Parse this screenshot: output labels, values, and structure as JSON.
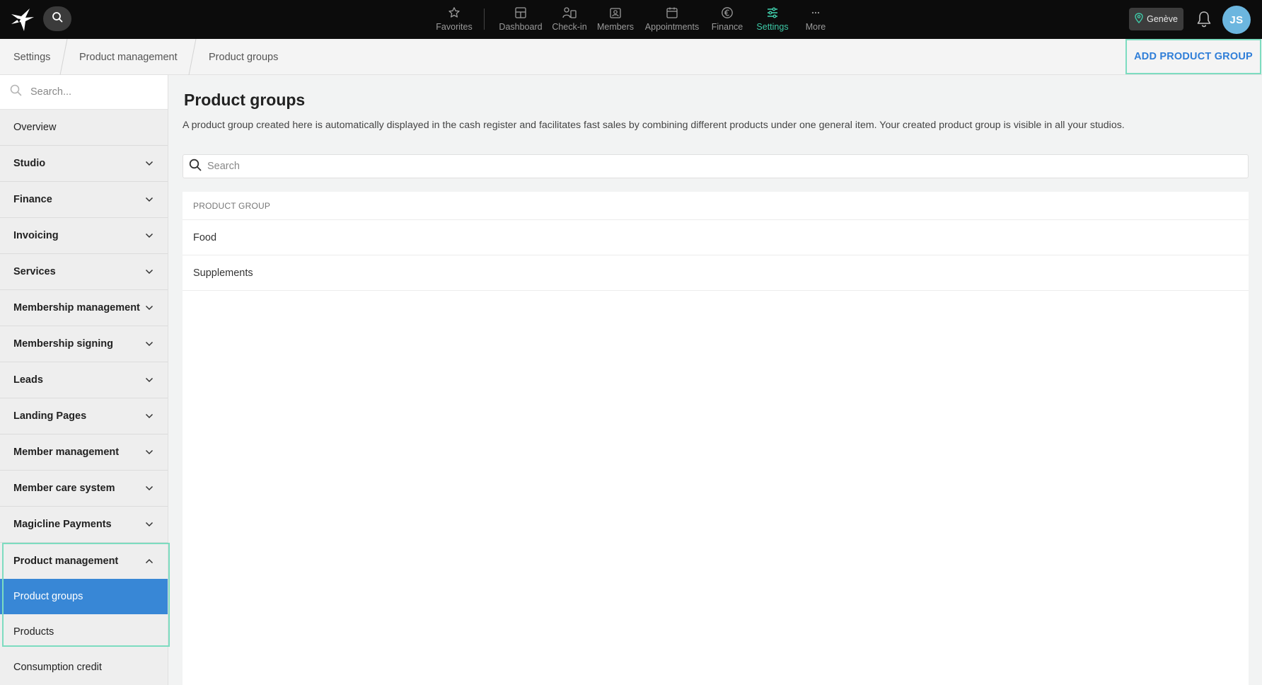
{
  "topnav": {
    "items": [
      {
        "label": "Favorites",
        "icon": "star-icon"
      },
      {
        "label": "Dashboard",
        "icon": "dashboard-icon"
      },
      {
        "label": "Check-in",
        "icon": "check-in-icon"
      },
      {
        "label": "Members",
        "icon": "members-icon"
      },
      {
        "label": "Appointments",
        "icon": "calendar-icon"
      },
      {
        "label": "Finance",
        "icon": "euro-icon"
      },
      {
        "label": "Settings",
        "icon": "sliders-icon"
      },
      {
        "label": "More",
        "icon": "more-icon"
      }
    ],
    "active": "Settings",
    "location": "Genève",
    "avatar_initials": "JS"
  },
  "breadcrumb": [
    "Settings",
    "Product management",
    "Product groups"
  ],
  "add_button_label": "ADD PRODUCT GROUP",
  "sidebar": {
    "search_placeholder": "Search...",
    "items": [
      {
        "label": "Overview"
      },
      {
        "label": "Studio"
      },
      {
        "label": "Finance"
      },
      {
        "label": "Invoicing"
      },
      {
        "label": "Services"
      },
      {
        "label": "Membership management"
      },
      {
        "label": "Membership signing"
      },
      {
        "label": "Leads"
      },
      {
        "label": "Landing Pages"
      },
      {
        "label": "Member management"
      },
      {
        "label": "Member care system"
      },
      {
        "label": "Magicline Payments"
      },
      {
        "label": "Product management"
      }
    ],
    "subitems": [
      {
        "label": "Product groups"
      },
      {
        "label": "Products"
      }
    ],
    "after": {
      "label": "Consumption credit"
    }
  },
  "main": {
    "title": "Product groups",
    "description": "A product group created here is automatically displayed in the cash register and facilitates fast sales by combining different products under one general item. Your created product group is visible in all your studios.",
    "search_placeholder": "Search",
    "table": {
      "header": "PRODUCT GROUP",
      "rows": [
        "Food",
        "Supplements"
      ]
    }
  },
  "colors": {
    "accent": "#3ec9a7",
    "primary": "#3887d6",
    "highlight_border": "#7ddcc0"
  }
}
